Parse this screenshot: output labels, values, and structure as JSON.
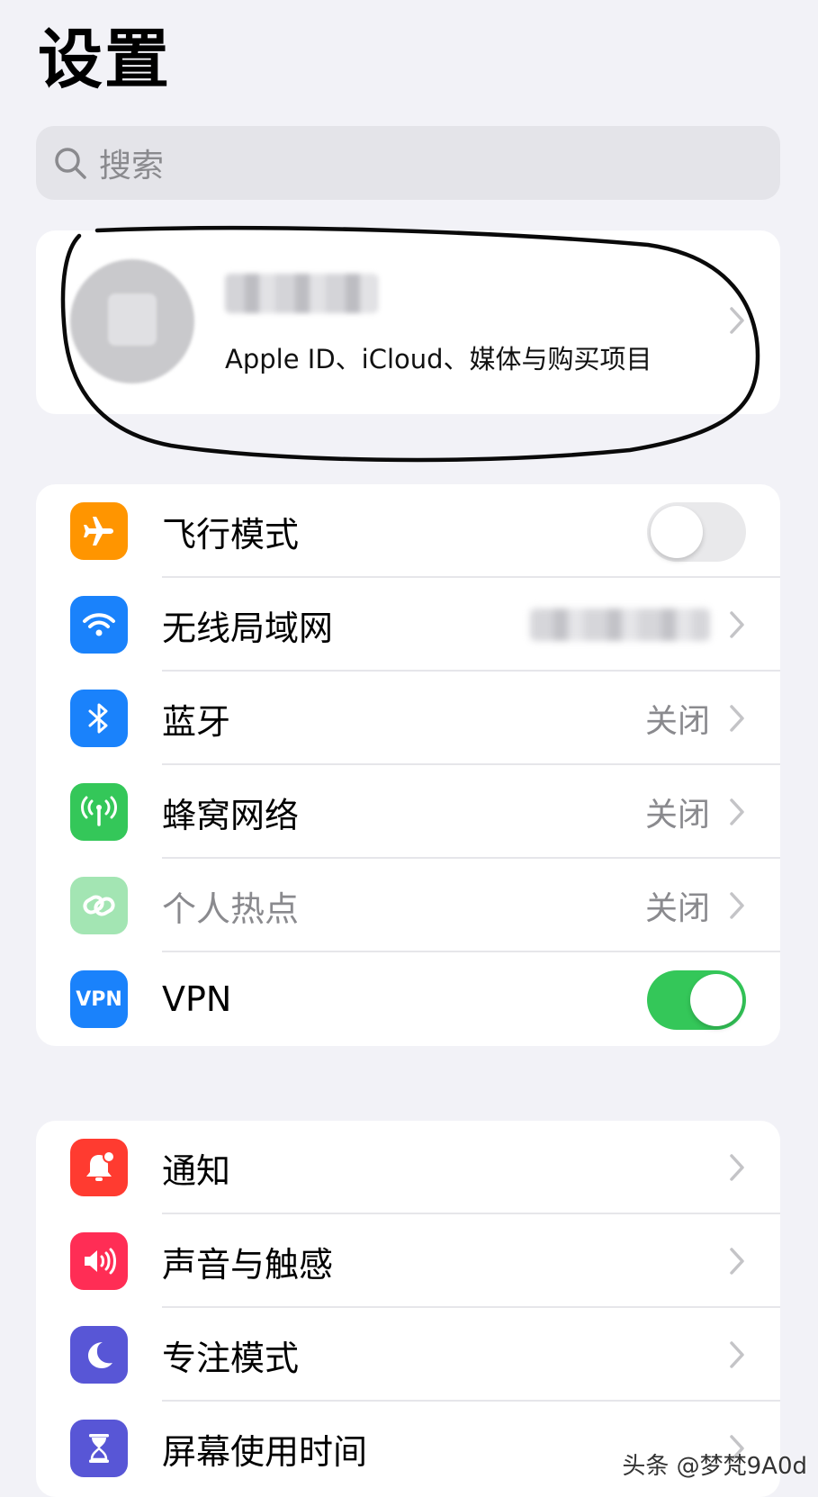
{
  "header": {
    "title": "设置"
  },
  "search": {
    "placeholder": "搜索"
  },
  "profile": {
    "subtitle": "Apple ID、iCloud、媒体与购买项目"
  },
  "connectivity": {
    "airplane": {
      "label": "飞行模式",
      "toggle": false
    },
    "wifi": {
      "label": "无线局域网"
    },
    "bluetooth": {
      "label": "蓝牙",
      "value": "关闭"
    },
    "cellular": {
      "label": "蜂窝网络",
      "value": "关闭"
    },
    "hotspot": {
      "label": "个人热点",
      "value": "关闭"
    },
    "vpn": {
      "label": "VPN",
      "icon_text": "VPN",
      "toggle": true
    }
  },
  "general": {
    "notifications": {
      "label": "通知"
    },
    "sounds": {
      "label": "声音与触感"
    },
    "focus": {
      "label": "专注模式"
    },
    "screen_time": {
      "label": "屏幕使用时间"
    }
  },
  "colors": {
    "airplane": "#ff9500",
    "wifi": "#1a82fb",
    "bluetooth": "#1a82fb",
    "cellular": "#34c759",
    "hotspot": "#34c759",
    "vpn": "#1a82fb",
    "notifications": "#ff3b30",
    "sounds": "#ff2d55",
    "focus": "#5856d6",
    "screen_time": "#5856d6",
    "toggle_on": "#34c759"
  },
  "watermark": "头条 @梦梵9A0d"
}
